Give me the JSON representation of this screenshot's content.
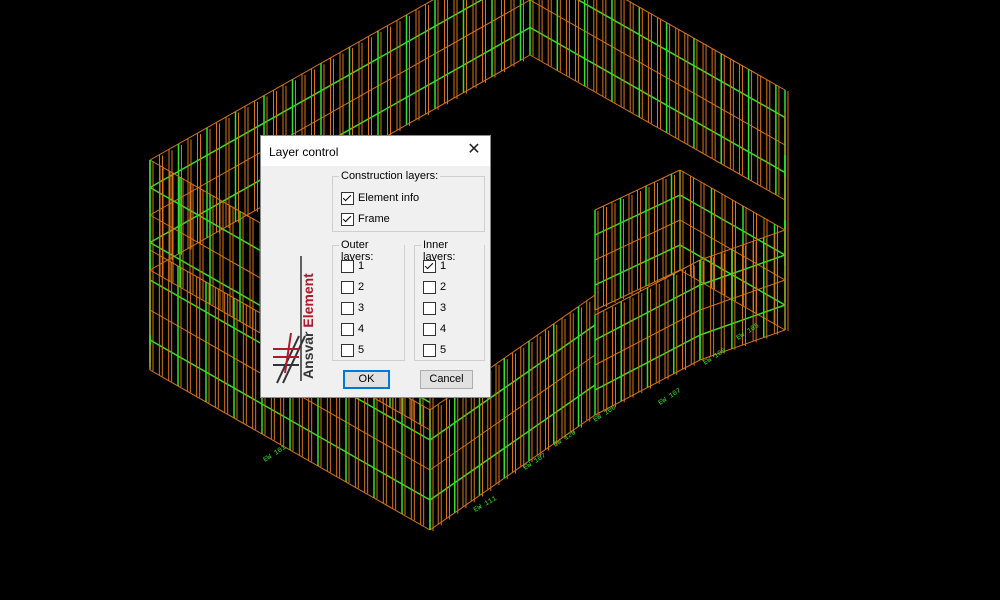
{
  "drawing": {
    "wall_labels": [
      "EW 101",
      "EW 111",
      "EW 107",
      "EW 120",
      "EW 106",
      "EW 107",
      "EW 105",
      "EW 105"
    ]
  },
  "dialog": {
    "title": "Layer control",
    "construction_group": {
      "label": "Construction layers:",
      "items": [
        {
          "label": "Element info",
          "checked": true
        },
        {
          "label": "Frame",
          "checked": true
        }
      ]
    },
    "outer_group": {
      "label": "Outer layers:",
      "items": [
        {
          "label": "1",
          "checked": false
        },
        {
          "label": "2",
          "checked": false
        },
        {
          "label": "3",
          "checked": false
        },
        {
          "label": "4",
          "checked": false
        },
        {
          "label": "5",
          "checked": false
        }
      ]
    },
    "inner_group": {
      "label": "Inner layers:",
      "items": [
        {
          "label": "1",
          "checked": true
        },
        {
          "label": "2",
          "checked": false
        },
        {
          "label": "3",
          "checked": false
        },
        {
          "label": "4",
          "checked": false
        },
        {
          "label": "5",
          "checked": false
        }
      ]
    },
    "ok_label": "OK",
    "cancel_label": "Cancel",
    "logo_text": "Ansvar Element"
  },
  "colors": {
    "frame_orange": "#d9731a",
    "frame_green": "#33e02a",
    "logo_red": "#b0182c"
  }
}
